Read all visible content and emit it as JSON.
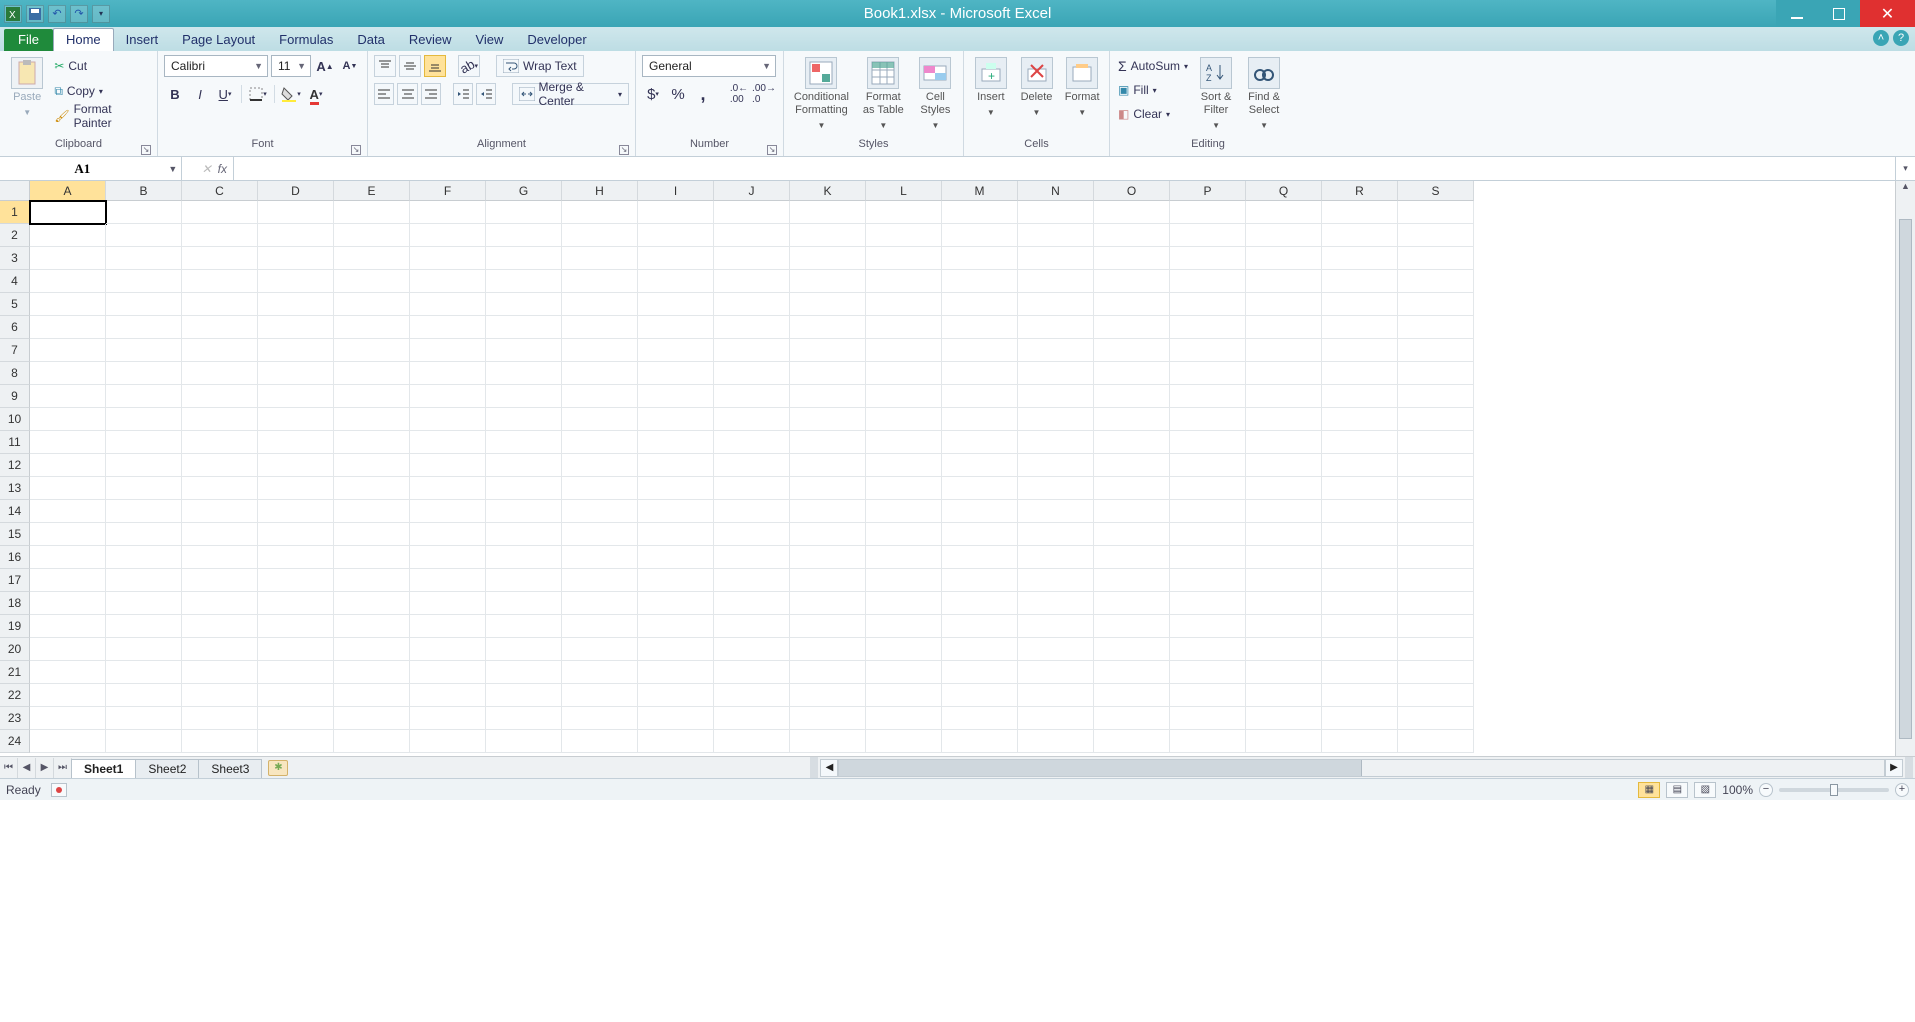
{
  "title": "Book1.xlsx - Microsoft Excel",
  "qat": {
    "save": "save",
    "undo": "undo",
    "redo": "redo"
  },
  "tabs": {
    "file": "File",
    "items": [
      "Home",
      "Insert",
      "Page Layout",
      "Formulas",
      "Data",
      "Review",
      "View",
      "Developer"
    ],
    "active": "Home"
  },
  "ribbon": {
    "clipboard": {
      "label": "Clipboard",
      "paste": "Paste",
      "cut": "Cut",
      "copy": "Copy",
      "format_painter": "Format Painter"
    },
    "font": {
      "label": "Font",
      "name": "Calibri",
      "size": "11"
    },
    "alignment": {
      "label": "Alignment",
      "wrap": "Wrap Text",
      "merge": "Merge & Center"
    },
    "number": {
      "label": "Number",
      "format": "General"
    },
    "styles": {
      "label": "Styles",
      "cond": "Conditional\nFormatting",
      "table": "Format\nas Table",
      "cell": "Cell\nStyles"
    },
    "cells": {
      "label": "Cells",
      "insert": "Insert",
      "delete": "Delete",
      "format": "Format"
    },
    "editing": {
      "label": "Editing",
      "autosum": "AutoSum",
      "fill": "Fill",
      "clear": "Clear",
      "sort": "Sort &\nFilter",
      "find": "Find &\nSelect"
    }
  },
  "namebox": "A1",
  "formula": "",
  "columns": [
    "A",
    "B",
    "C",
    "D",
    "E",
    "F",
    "G",
    "H",
    "I",
    "J",
    "K",
    "L",
    "M",
    "N",
    "O",
    "P",
    "Q",
    "R",
    "S"
  ],
  "rows": [
    1,
    2,
    3,
    4,
    5,
    6,
    7,
    8,
    9,
    10,
    11,
    12,
    13,
    14,
    15,
    16,
    17,
    18,
    19,
    20,
    21,
    22,
    23,
    24
  ],
  "selected_cell": "A1",
  "sheets": {
    "items": [
      "Sheet1",
      "Sheet2",
      "Sheet3"
    ],
    "active": "Sheet1"
  },
  "status": {
    "ready": "Ready",
    "zoom": "100%"
  }
}
